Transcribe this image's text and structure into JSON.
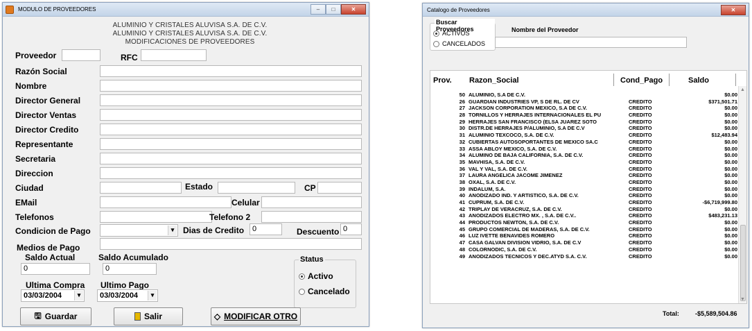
{
  "left_window": {
    "title": "MODULO DE PROVEEDORES",
    "header_lines": [
      "ALUMINIO Y CRISTALES ALUVISA S.A. DE C.V.",
      "ALUMINIO Y CRISTALES ALUVISA S.A. DE C.V.",
      "MODIFICACIONES DE PROVEEDORES"
    ],
    "labels": {
      "proveedor": "Proveedor",
      "rfc": "RFC",
      "razon_social": "Razón Social",
      "nombre": "Nombre",
      "director_general": "Director General",
      "director_ventas": "Director Ventas",
      "director_credito": "Director Credito",
      "representante": "Representante",
      "secretaria": "Secretaria",
      "direccion": "Direccion",
      "ciudad": "Ciudad",
      "estado": "Estado",
      "cp": "CP",
      "email": "EMail",
      "celular": "Celular",
      "telefonos": "Telefonos",
      "telefono2": "Telefono  2",
      "condicion_pago": "Condicion de Pago",
      "dias_credito": "Dias de Credito",
      "descuento": "Descuento",
      "medios_pago": "Medios de Pago",
      "saldo_actual": "Saldo Actual",
      "saldo_acumulado": "Saldo Acumulado",
      "ultima_compra": "Ultima Compra",
      "ultimo_pago": "Ultimo Pago"
    },
    "values": {
      "dias_credito": "0",
      "descuento": "0",
      "saldo_actual": "0",
      "saldo_acumulado": "0",
      "ultima_compra": "03/03/2004",
      "ultimo_pago": "03/03/2004"
    },
    "status": {
      "title": "Status",
      "option1": "Activo",
      "option2": "Cancelado",
      "selected": "Activo"
    },
    "buttons": {
      "guardar": "Guardar",
      "salir": "Salir",
      "modificar": "MODIFICAR OTRO"
    }
  },
  "right_window": {
    "title": "Catalogo de Proveedores",
    "search_group": "Buscar Proveedores",
    "option_activos": "ACTIVOS",
    "option_cancelados": "CANCELADOS",
    "name_label": "Nombre del  Proveedor",
    "columns": [
      "Prov.",
      "Razon_Social",
      "Cond_Pago",
      "Saldo"
    ],
    "rows": [
      [
        "50",
        "ALUMINIO, S.A DE C.V.",
        "",
        "$0.00"
      ],
      [
        "26",
        "GUARDIAN INDUSTRIES VP, S DE RL. DE CV",
        "CREDITO",
        "$371,501.71"
      ],
      [
        "27",
        "JACKSON CORPORATION MEXICO, S.A DE C.V.",
        "CREDITO",
        "$0.00"
      ],
      [
        "28",
        "TORNILLOS Y HERRAJES INTERNACIONALES EL PU",
        "CREDITO",
        "$0.00"
      ],
      [
        "29",
        "HERRAJES SAN FRANCISCO (ELSA JUAREZ SOTO",
        "CREDITO",
        "$0.00"
      ],
      [
        "30",
        "DISTR.DE HERRAJES P/ALUMINIO, S.A DE C.V",
        "CREDITO",
        "$0.00"
      ],
      [
        "31",
        "ALUMINIO TEXCOCO, S.A. DE C.V.",
        "CREDITO",
        "$12,483.94"
      ],
      [
        "32",
        "CUBIERTAS AUTOSOPORTANTES DE MEXICO SA.C",
        "CREDITO",
        "$0.00"
      ],
      [
        "33",
        "ASSA ABLOY MEXICO, S.A. DE C.V.",
        "CREDITO",
        "$0.00"
      ],
      [
        "34",
        "ALUMINO DE BAJA CALIFORNIA, S.A. DE C.V.",
        "CREDITO",
        "$0.00"
      ],
      [
        "35",
        "MAVHISA, S.A. DE C.V.",
        "CREDITO",
        "$0.00"
      ],
      [
        "36",
        "VAL Y VAL, S.A. DE C.V.",
        "CREDITO",
        "$0.00"
      ],
      [
        "37",
        "LAURA ANGELICA JACOME JIMENEZ",
        "CREDITO",
        "$0.00"
      ],
      [
        "38",
        "OXAL, S.A. DE C.V.",
        "CREDITO",
        "$0.00"
      ],
      [
        "39",
        "INDALUM, S.A.",
        "CREDITO",
        "$0.00"
      ],
      [
        "40",
        "ANODIZADO IND. Y ARTISTICO, S.A. DE C.V.",
        "CREDITO",
        "$0.00"
      ],
      [
        "41",
        "CUPRUM, S.A. DE C.V.",
        "CREDITO",
        "-$6,719,999.80"
      ],
      [
        "42",
        "TRIPLAY DE VERACRUZ, S.A. DE C.V.",
        "CREDITO",
        "$0.00"
      ],
      [
        "43",
        "ANODIZADOS ELECTRO MX. , S.A. DE C.V..",
        "CREDITO",
        "$483,231.13"
      ],
      [
        "44",
        "PRODUCTOS NEWTON, S.A. DE C.V.",
        "CREDITO",
        "$0.00"
      ],
      [
        "45",
        "GRUPO COMERCIAL DE MADERAS, S.A. DE C.V.",
        "CREDITO",
        "$0.00"
      ],
      [
        "46",
        "LUZ IVETTE BENAVIDES ROMERO",
        "CREDITO",
        "$0.00"
      ],
      [
        "47",
        "CASA GALVAN DIVISION VIDRIO, S.A. DE C.V",
        "CREDITO",
        "$0.00"
      ],
      [
        "48",
        "COLORNODIC, S.A. DE C.V.",
        "CREDITO",
        "$0.00"
      ],
      [
        "49",
        "ANODIZADOS TECNICOS Y DEC.ATYD S.A. C.V.",
        "CREDITO",
        "$0.00"
      ]
    ],
    "total_label": "Total:",
    "total_value": "-$5,589,504.86"
  }
}
